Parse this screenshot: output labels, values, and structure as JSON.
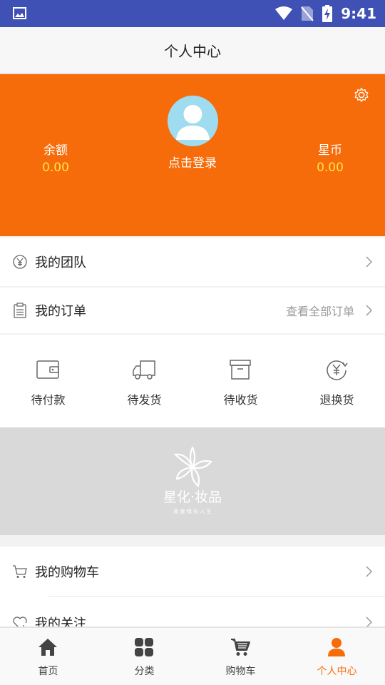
{
  "status_bar": {
    "time": "9:41"
  },
  "header": {
    "title": "个人中心"
  },
  "profile": {
    "login_text": "点击登录",
    "balance": {
      "label": "余额",
      "value": "0.00"
    },
    "star_coin": {
      "label": "星币",
      "value": "0.00"
    }
  },
  "menu": {
    "team": {
      "label": "我的团队"
    },
    "orders": {
      "label": "我的订单",
      "view_all": "查看全部订单"
    },
    "cart": {
      "label": "我的购物车"
    },
    "follow": {
      "label": "我的关注"
    }
  },
  "order_status": [
    {
      "label": "待付款",
      "icon": "wallet-icon"
    },
    {
      "label": "待发货",
      "icon": "truck-icon"
    },
    {
      "label": "待收货",
      "icon": "box-icon"
    },
    {
      "label": "退换货",
      "icon": "refund-icon"
    }
  ],
  "banner": {
    "brand": "星化·妆品",
    "slogan": "简 爱 精 彩 人 生"
  },
  "tabbar": [
    {
      "label": "首页",
      "icon": "home-icon"
    },
    {
      "label": "分类",
      "icon": "category-icon"
    },
    {
      "label": "购物车",
      "icon": "cart-icon"
    },
    {
      "label": "个人中心",
      "icon": "user-icon"
    }
  ],
  "colors": {
    "accent": "#f76c0a",
    "status_bar": "#3f51b5",
    "value_yellow": "#ffe24a"
  }
}
